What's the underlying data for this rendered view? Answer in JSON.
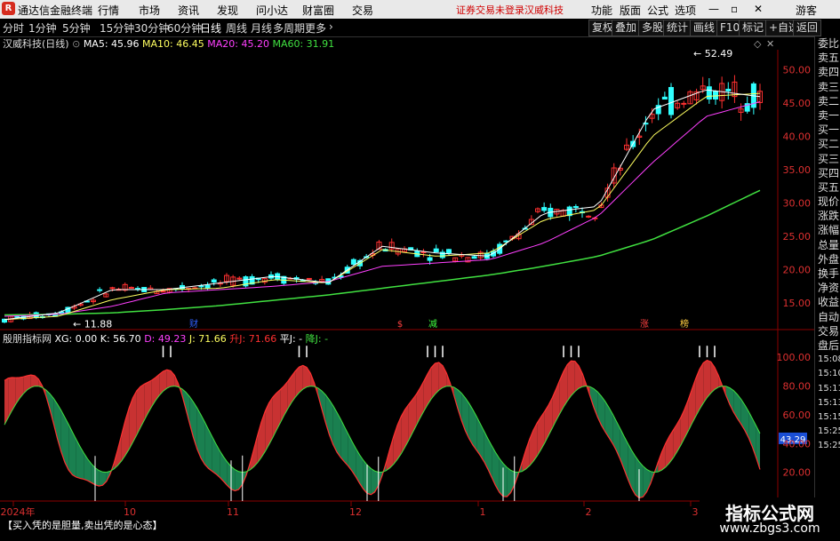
{
  "menubar": {
    "logo": "R",
    "app_name": "通达信金融终端",
    "items": [
      "行情",
      "市场",
      "资讯",
      "发现",
      "问小达",
      "财富圈",
      "交易"
    ],
    "warning": "证券交易未登录",
    "stock_name": "汉威科技",
    "right_items": [
      "功能",
      "版面",
      "公式",
      "选项"
    ],
    "guest": "游客"
  },
  "toolbar": {
    "left_items": [
      "分时",
      "1分钟",
      "5分钟",
      "15分钟",
      "30分钟",
      "60分钟",
      "日线",
      "周线",
      "月线",
      "多周期",
      "更多"
    ],
    "right_items": [
      "复权",
      "叠加",
      "多股",
      "统计",
      "画线",
      "F10",
      "标记",
      "+自选",
      "返回"
    ]
  },
  "price_info": {
    "title": "汉威科技(日线)",
    "ma5": "MA5: 45.96",
    "ma10": "MA10: 46.45",
    "ma20": "MA20: 45.20",
    "ma60": "MA60: 31.91"
  },
  "price_axis": [
    "50.00",
    "45.00",
    "40.00",
    "35.00",
    "30.00",
    "25.00",
    "20.00",
    "15.00"
  ],
  "price_markers": {
    "high": "52.49",
    "low": "11.88"
  },
  "event_markers": [
    "财",
    "$",
    "减",
    "涨",
    "榜"
  ],
  "indicator_info": {
    "name": "殷朋指标网",
    "xg": "XG: 0.00",
    "k": "K: 56.70",
    "d": "D: 49.23",
    "j": "J: 71.66",
    "up_j": "升J: 71.66",
    "flat_j": "平J: -",
    "down_j": "降J: -"
  },
  "indicator_axis": [
    "100.00",
    "80.00",
    "60.00",
    "40.00",
    "20.00"
  ],
  "indicator_current": "43.29",
  "indicator_note": "【买入凭的是胆量,卖出凭的是心态】",
  "date_axis": [
    "2024年",
    "10",
    "11",
    "12",
    "1",
    "2",
    "3"
  ],
  "right_panel": [
    "委比",
    "卖五",
    "卖四",
    "卖三",
    "卖二",
    "卖一",
    "买一",
    "买二",
    "买三",
    "买四",
    "买五",
    "现价",
    "涨跌",
    "涨幅",
    "总量",
    "外盘",
    "换手",
    "净资",
    "收益",
    "自动",
    "交易",
    "盘后",
    "15:08",
    "15:10",
    "15:11",
    "15:13",
    "15:15",
    "15:25",
    "15:25"
  ],
  "watermark": {
    "title": "指标公式网",
    "url": "www.zbgs3.com"
  },
  "colors": {
    "up": "#ff3030",
    "down": "#30ffff",
    "ma5": "#ffffff",
    "ma10": "#ffff60",
    "ma20": "#ff40ff",
    "ma60": "#40e040",
    "bar_red": "#c83232",
    "bar_green": "#1a8050"
  },
  "chart_data": {
    "type": "line",
    "series": [
      {
        "name": "MA60",
        "values": [
          13.2,
          13.3,
          13.5,
          14.0,
          14.6,
          15.4,
          16.2,
          17.2,
          18.2,
          19.2,
          20.5,
          22.0,
          24.5,
          28.0,
          31.9
        ]
      },
      {
        "name": "MA20",
        "values": [
          13.0,
          13.3,
          14.5,
          16.5,
          17.0,
          17.5,
          18.2,
          20.5,
          21.0,
          21.5,
          24.0,
          28.0,
          36.0,
          43.0,
          45.2
        ]
      },
      {
        "name": "MA10",
        "values": [
          12.5,
          13.0,
          15.5,
          17.0,
          17.2,
          18.5,
          18.0,
          23.0,
          22.0,
          22.5,
          27.5,
          29.0,
          40.0,
          46.0,
          46.45
        ]
      },
      {
        "name": "MA5",
        "values": [
          12.5,
          13.5,
          17.0,
          17.0,
          18.0,
          19.0,
          18.0,
          23.5,
          22.5,
          22.0,
          28.5,
          29.5,
          44.0,
          47.0,
          45.96
        ]
      }
    ],
    "ylim": [
      11,
      53
    ]
  }
}
